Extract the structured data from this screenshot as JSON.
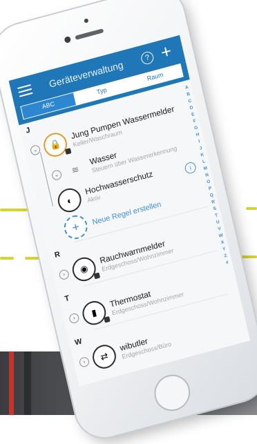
{
  "navbar": {
    "title": "Geräteverwaltung",
    "help_symbol": "?",
    "add_symbol": "+"
  },
  "segments": [
    {
      "label": "ABC",
      "active": true
    },
    {
      "label": "Typ",
      "active": false
    },
    {
      "label": "Raum",
      "active": false
    }
  ],
  "sections": {
    "j": {
      "letter": "J",
      "device": {
        "name": "Jung Pumpen Wassermelder",
        "location": "Keller/Waschraum",
        "icon": "pump-icon"
      },
      "rule1": {
        "name": "Wasser",
        "detail": "Steuern über Wassererkennung",
        "icon": "water-icon"
      },
      "rule2": {
        "name": "Hochwasserschutz",
        "status": "Aktiv",
        "icon": "flood-protection-icon",
        "info": "i"
      },
      "new_rule": {
        "label": "Neue Regel erstellen",
        "symbol": "+"
      }
    },
    "r": {
      "letter": "R",
      "device": {
        "name": "Rauchwarnmelder",
        "location": "Erdgeschoss/Wohnzimmer",
        "icon": "smoke-detector-icon"
      }
    },
    "t": {
      "letter": "T",
      "device": {
        "name": "Thermostat",
        "location": "Erdgeschoss/Wohnzimmer",
        "icon": "thermostat-icon"
      }
    },
    "w": {
      "letter": "W",
      "device": {
        "name": "wibutler",
        "location": "Erdgeschoss/Büro",
        "icon": "wibutler-icon"
      }
    }
  },
  "index_letters": [
    "A",
    "B",
    "C",
    "D",
    "E",
    "F",
    "G",
    "H",
    "I",
    "J",
    "K",
    "L",
    "M",
    "N",
    "O",
    "P",
    "Q",
    "R",
    "S",
    "T",
    "U",
    "V",
    "W",
    "X",
    "Y",
    "Z",
    "#"
  ],
  "colors": {
    "accent": "#2077b7",
    "link": "#3d8fd6",
    "dash": "#d8d231"
  }
}
